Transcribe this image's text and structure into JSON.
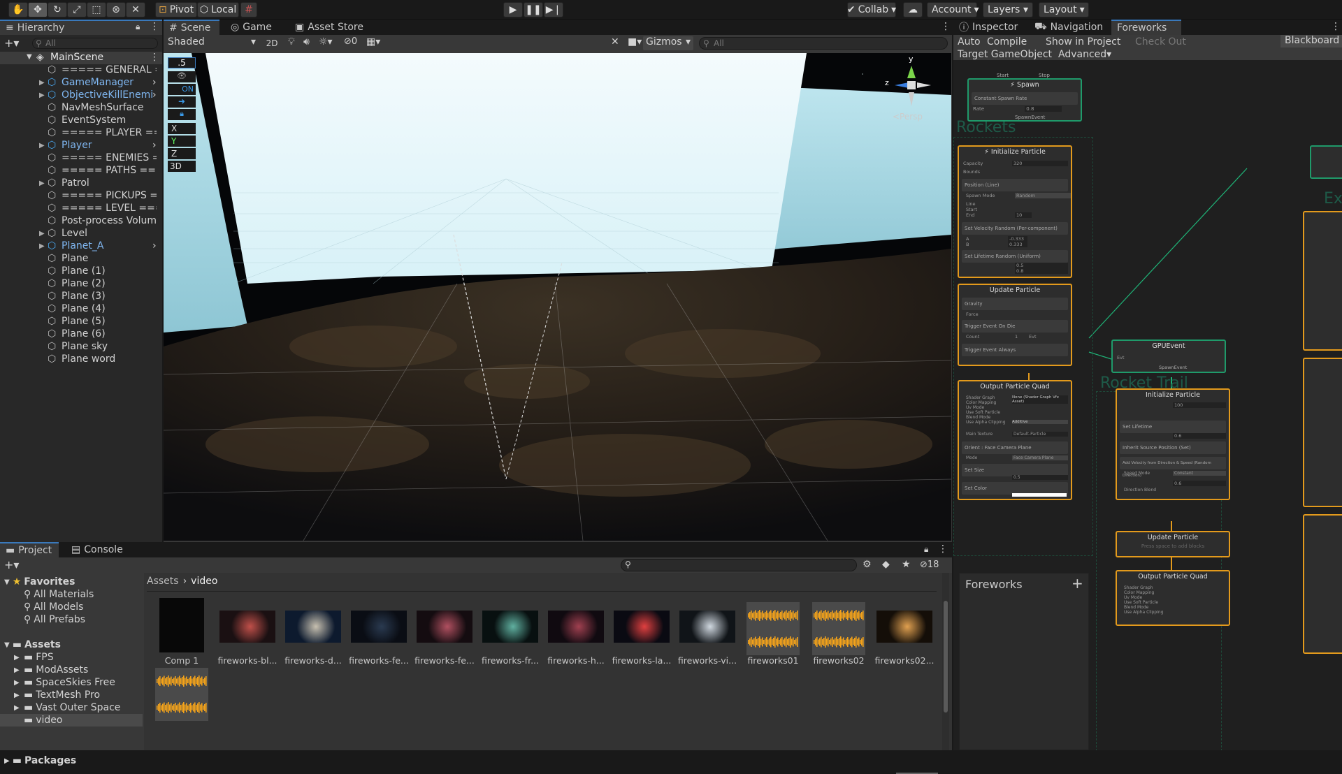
{
  "toolbar": {
    "pivot": "Pivot",
    "local": "Local",
    "collab": "Collab",
    "account": "Account",
    "layers": "Layers",
    "layout": "Layout"
  },
  "hierarchy": {
    "tab": "Hierarchy",
    "search_placeholder": "All",
    "scene": "MainScene",
    "items": [
      {
        "label": "===== GENERAL ===",
        "blue": false,
        "arrow": false
      },
      {
        "label": "GameManager",
        "blue": true,
        "arrow": true
      },
      {
        "label": "ObjectiveKillEnemi",
        "blue": true,
        "arrow": true
      },
      {
        "label": "NavMeshSurface",
        "blue": false,
        "arrow": false
      },
      {
        "label": "EventSystem",
        "blue": false,
        "arrow": false
      },
      {
        "label": "===== PLAYER ====",
        "blue": false,
        "arrow": false
      },
      {
        "label": "Player",
        "blue": true,
        "arrow": true
      },
      {
        "label": "===== ENEMIES ===",
        "blue": false,
        "arrow": false
      },
      {
        "label": "===== PATHS =====",
        "blue": false,
        "arrow": false
      },
      {
        "label": "Patrol",
        "blue": false,
        "arrow": false
      },
      {
        "label": "===== PICKUPS ===",
        "blue": false,
        "arrow": false
      },
      {
        "label": "===== LEVEL =====",
        "blue": false,
        "arrow": false
      },
      {
        "label": "Post-process Volume",
        "blue": false,
        "arrow": false
      },
      {
        "label": "Level",
        "blue": false,
        "arrow": false
      },
      {
        "label": "Planet_A",
        "blue": true,
        "arrow": true
      },
      {
        "label": "Plane",
        "blue": false,
        "arrow": false
      },
      {
        "label": "Plane (1)",
        "blue": false,
        "arrow": false
      },
      {
        "label": "Plane (2)",
        "blue": false,
        "arrow": false
      },
      {
        "label": "Plane (3)",
        "blue": false,
        "arrow": false
      },
      {
        "label": "Plane (4)",
        "blue": false,
        "arrow": false
      },
      {
        "label": "Plane (5)",
        "blue": false,
        "arrow": false
      },
      {
        "label": "Plane (6)",
        "blue": false,
        "arrow": false
      },
      {
        "label": "Plane sky",
        "blue": false,
        "arrow": false
      },
      {
        "label": "Plane word",
        "blue": false,
        "arrow": false
      }
    ]
  },
  "scene": {
    "tabs": {
      "scene": "Scene",
      "game": "Game",
      "asset_store": "Asset Store"
    },
    "shading": "Shaded",
    "mode_2d": "2D",
    "hidden_count": "0",
    "gizmos": "Gizmos",
    "search_placeholder": "All",
    "persp": "<Persp",
    "gizmo_y": "y",
    "gizmo_z": "z",
    "overlay": {
      "snap": ".5",
      "on": "ON",
      "x": "X",
      "y": "Y",
      "z": "Z",
      "d3": "3D"
    }
  },
  "project": {
    "tabs": {
      "project": "Project",
      "console": "Console"
    },
    "hidden_count": "18",
    "favorites": {
      "label": "Favorites",
      "items": [
        "All Materials",
        "All Models",
        "All Prefabs"
      ]
    },
    "assets": {
      "label": "Assets",
      "items": [
        "FPS",
        "ModAssets",
        "SpaceSkies Free",
        "TextMesh Pro",
        "Vast Outer Space",
        "video"
      ]
    },
    "packages": "Packages",
    "breadcrumb": {
      "root": "Assets",
      "current": "video"
    },
    "files": [
      {
        "name": "Comp 1",
        "kind": "doc"
      },
      {
        "name": "fireworks-bl...",
        "kind": "red"
      },
      {
        "name": "fireworks-d...",
        "kind": "planet"
      },
      {
        "name": "fireworks-fe...",
        "kind": "dark"
      },
      {
        "name": "fireworks-fe...",
        "kind": "red2"
      },
      {
        "name": "fireworks-fr...",
        "kind": "green"
      },
      {
        "name": "fireworks-h...",
        "kind": "red3"
      },
      {
        "name": "fireworks-la...",
        "kind": "redglow"
      },
      {
        "name": "fireworks-vi...",
        "kind": "moon"
      },
      {
        "name": "fireworks01",
        "kind": "audio"
      },
      {
        "name": "fireworks02",
        "kind": "audio"
      },
      {
        "name": "fireworks02...",
        "kind": "orange"
      },
      {
        "name": "",
        "kind": "audio"
      }
    ]
  },
  "inspector": {
    "tabs": {
      "inspector": "Inspector",
      "navigation": "Navigation",
      "foreworks": "Foreworks"
    },
    "toolbar": {
      "auto": "Auto",
      "compile": "Compile",
      "show_in_project": "Show in Project",
      "check_out": "Check Out",
      "blackboard": "Blackboard",
      "target": "Target GameObject",
      "advanced": "Advanced"
    },
    "blackboard_title": "Foreworks",
    "graph": {
      "spawn": {
        "start": "Start",
        "stop": "Stop",
        "title": "Spawn",
        "block": "Constant Spawn Rate",
        "rate_label": "Rate",
        "rate": "0.8",
        "out": "SpawnEvent"
      },
      "rockets_group": "Rockets",
      "init": {
        "title": "Initialize Particle",
        "capacity_label": "Capacity",
        "capacity": "320",
        "bounds": "Bounds",
        "position": "Position (Line)",
        "spawn_mode": "Spawn Mode",
        "spawn_mode_val": "Random",
        "line": "Line",
        "start": "Start",
        "end": "End",
        "end_val": "10",
        "velocity": "Set Velocity Random (Per-component)",
        "va": "A",
        "vb": "B",
        "va_x": "-0.333",
        "vb_x": "0.333",
        "lifetime": "Set Lifetime Random (Uniform)",
        "la": "0.5",
        "lb": "0.8",
        "particle": "Particle"
      },
      "update": {
        "title": "Update Particle",
        "gravity": "Gravity",
        "force": "Force",
        "trigger_die": "Trigger Event On Die",
        "count": "Count",
        "count_val": "1",
        "evt": "Evt",
        "trigger_always": "Trigger Event Always",
        "particle": "Particle"
      },
      "output": {
        "title": "Output Particle Quad",
        "shader": "Shader Graph",
        "shader_val": "None (Shader Graph Vfx Asset)",
        "color_map": "Color Mapping",
        "uv": "Uv Mode",
        "soft": "Use Soft Particle",
        "blend": "Blend Mode",
        "blend_val": "Additive",
        "alpha": "Use Alpha Clipping",
        "main_tex": "Main Texture",
        "main_tex_val": "Default-Particle",
        "orient": "Orient : Face Camera Plane",
        "mode": "Mode",
        "mode_val": "Face Camera Plane",
        "size": "Set Size",
        "size_val": "0.5",
        "color": "Set Color",
        "color_nums": "33.8967 | 26.0880 | 10.6482"
      },
      "gpu_event": {
        "title": "GPUEvent",
        "evt": "Evt",
        "out": "SpawnEvent"
      },
      "trail_group": "Rocket Trail",
      "init2": {
        "title": "Initialize Particle",
        "capacity": "100",
        "lifetime": "Set Lifetime",
        "lifetime_val": "0.6",
        "inherit": "Inherit Source Position (Set)",
        "add_vel": "Add Velocity from Direction & Speed (Random Direction)",
        "speed_mode": "Speed Mode",
        "speed_mode_val": "Constant",
        "speed_val": "0.6",
        "dir_blend": "Direction Blend"
      },
      "update2": {
        "title": "Update Particle",
        "hint": "Press space to add blocks"
      },
      "output2": {
        "title": "Output Particle Quad"
      },
      "expl_group": "Expl"
    }
  }
}
